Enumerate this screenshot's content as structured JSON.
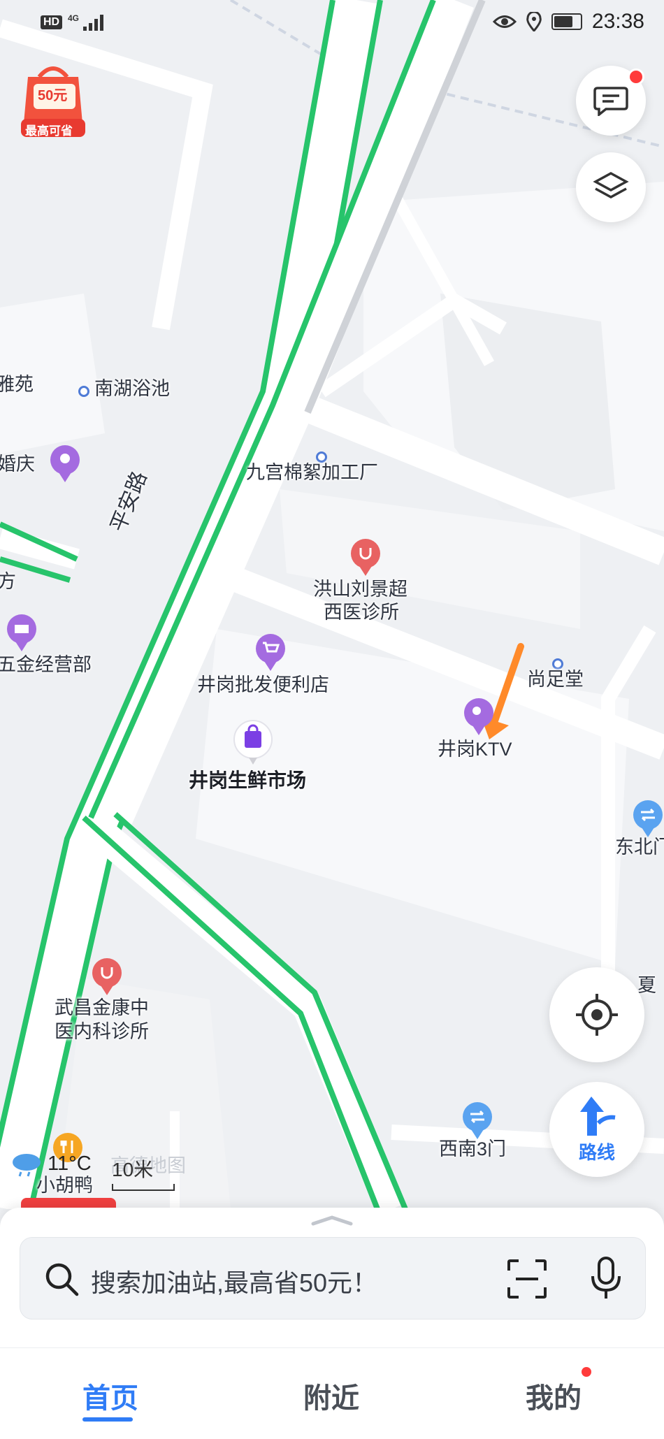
{
  "status": {
    "network": "4G",
    "time": "23:38"
  },
  "coupon": {
    "amount": "50元",
    "caption": "最高可省"
  },
  "pois": {
    "nanhu_bath": "南湖浴池",
    "ya_yuan": "雅苑",
    "hun_qing": "婚庆",
    "ping_an_road": "平安路",
    "jiugong_factory": "九宫棉絮加工厂",
    "clinic_1_line1": "洪山刘景超",
    "clinic_1_line2": "西医诊所",
    "fang_partial": "方",
    "wujin": "五金经营部",
    "jinggang_store": "井岗批发便利店",
    "shang_zu_tang": "尚足堂",
    "jinggang_market": "井岗生鲜市场",
    "jinggang_ktv": "井岗KTV",
    "dongbei_gate": "东北门",
    "xia_partial": "夏",
    "clinic_2_line1": "武昌金康中",
    "clinic_2_line2": "医内科诊所",
    "southwest_gate": "西南3门",
    "xiao_hu_ya": "小胡鸭",
    "gaode_watermark": "高德地图"
  },
  "weather": {
    "temp": "11°C"
  },
  "scale": {
    "label": "10米"
  },
  "route_button": {
    "label": "路线"
  },
  "search": {
    "placeholder": "搜索加油站,最高省50元！"
  },
  "tabs": [
    {
      "label": "首页",
      "active": true
    },
    {
      "label": "附近",
      "active": false
    },
    {
      "label": "我的",
      "active": false
    }
  ],
  "colors": {
    "accent": "#2f7cf6",
    "road_green": "#27c46b",
    "arrow_orange": "#ff8a2a"
  }
}
